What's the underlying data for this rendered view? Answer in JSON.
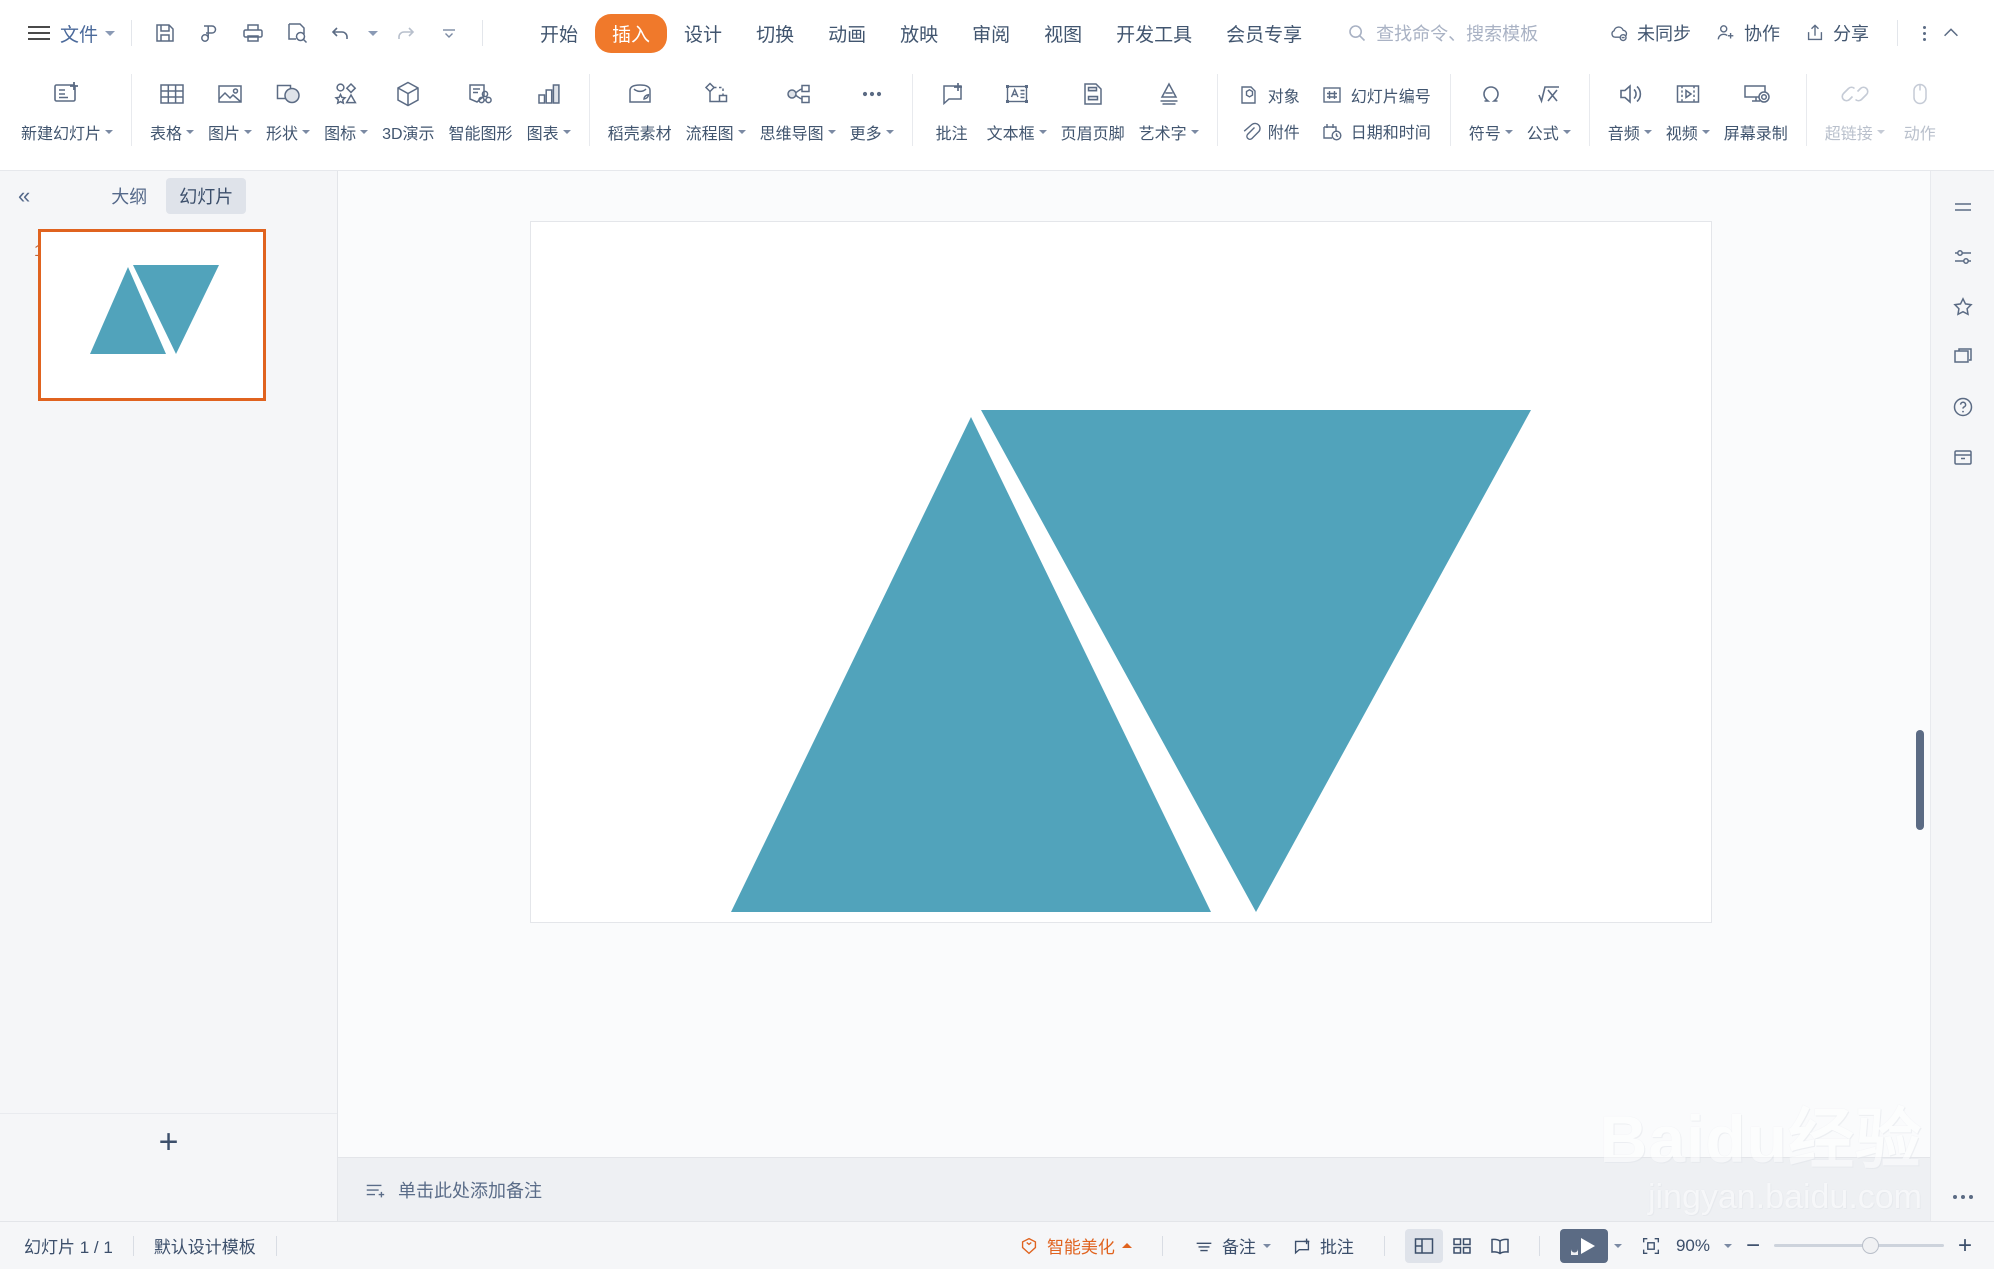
{
  "titlebar": {
    "menu_icon": "hamburger-icon",
    "file_label": "文件",
    "quick_access": [
      {
        "name": "save-icon",
        "label": "保存"
      },
      {
        "name": "cloud-save-icon",
        "label": "云同步"
      },
      {
        "name": "print-icon",
        "label": "打印"
      },
      {
        "name": "print-preview-icon",
        "label": "打印预览"
      },
      {
        "name": "undo-icon",
        "label": "撤销"
      },
      {
        "name": "redo-icon",
        "label": "恢复"
      },
      {
        "name": "customize-qat-icon",
        "label": "自定义快速访问工具栏"
      }
    ],
    "tabs": [
      {
        "label": "开始",
        "active": false
      },
      {
        "label": "插入",
        "active": true
      },
      {
        "label": "设计",
        "active": false
      },
      {
        "label": "切换",
        "active": false
      },
      {
        "label": "动画",
        "active": false
      },
      {
        "label": "放映",
        "active": false
      },
      {
        "label": "审阅",
        "active": false
      },
      {
        "label": "视图",
        "active": false
      },
      {
        "label": "开发工具",
        "active": false
      },
      {
        "label": "会员专享",
        "active": false
      }
    ],
    "search": {
      "icon": "search-icon",
      "placeholder": "查找命令、搜索模板"
    },
    "right_items": [
      {
        "icon": "cloud-sync-icon",
        "label": "未同步"
      },
      {
        "icon": "collaborate-icon",
        "label": "协作"
      },
      {
        "icon": "share-icon",
        "label": "分享"
      }
    ],
    "more_icon": "vertical-dots-icon",
    "collapse_ribbon_icon": "chevron-up-icon"
  },
  "ribbon": {
    "groups": [
      {
        "items": [
          {
            "icon": "new-slide-icon",
            "label": "新建幻灯片",
            "dropdown": true,
            "disabled": false
          }
        ]
      },
      {
        "items": [
          {
            "icon": "table-icon",
            "label": "表格",
            "dropdown": true,
            "disabled": false
          },
          {
            "icon": "picture-icon",
            "label": "图片",
            "dropdown": true,
            "disabled": false
          },
          {
            "icon": "shape-icon",
            "label": "形状",
            "dropdown": true,
            "disabled": false
          },
          {
            "icon": "iconlib-icon",
            "label": "图标",
            "dropdown": true,
            "disabled": false
          },
          {
            "icon": "cube-3d-icon",
            "label": "3D演示",
            "dropdown": false,
            "disabled": false
          },
          {
            "icon": "smartart-icon",
            "label": "智能图形",
            "dropdown": false,
            "disabled": false
          },
          {
            "icon": "chart-icon",
            "label": "图表",
            "dropdown": true,
            "disabled": false
          }
        ]
      },
      {
        "items": [
          {
            "icon": "docer-store-icon",
            "label": "稻壳素材",
            "dropdown": false,
            "disabled": false
          },
          {
            "icon": "flowchart-icon",
            "label": "流程图",
            "dropdown": true,
            "disabled": false
          },
          {
            "icon": "mindmap-icon",
            "label": "思维导图",
            "dropdown": true,
            "disabled": false
          },
          {
            "icon": "more-dots-icon",
            "label": "更多",
            "dropdown": true,
            "disabled": false
          }
        ]
      },
      {
        "items": [
          {
            "icon": "comment-add-icon",
            "label": "批注",
            "dropdown": false,
            "disabled": false
          },
          {
            "icon": "textbox-icon",
            "label": "文本框",
            "dropdown": true,
            "disabled": false
          },
          {
            "icon": "header-footer-icon",
            "label": "页眉页脚",
            "dropdown": false,
            "disabled": false
          },
          {
            "icon": "wordart-icon",
            "label": "艺术字",
            "dropdown": true,
            "disabled": false
          }
        ]
      },
      {
        "stacked": [
          [
            {
              "icon": "object-icon",
              "label": "对象"
            },
            {
              "icon": "slide-number-icon",
              "label": "幻灯片编号"
            }
          ],
          [
            {
              "icon": "attachment-icon",
              "label": "附件"
            },
            {
              "icon": "date-time-icon",
              "label": "日期和时间"
            }
          ]
        ]
      },
      {
        "items": [
          {
            "icon": "symbol-omega-icon",
            "label": "符号",
            "dropdown": true,
            "disabled": false
          },
          {
            "icon": "formula-icon",
            "label": "公式",
            "dropdown": true,
            "disabled": false
          }
        ]
      },
      {
        "items": [
          {
            "icon": "audio-icon",
            "label": "音频",
            "dropdown": true,
            "disabled": false
          },
          {
            "icon": "video-icon",
            "label": "视频",
            "dropdown": true,
            "disabled": false
          },
          {
            "icon": "screen-record-icon",
            "label": "屏幕录制",
            "dropdown": false,
            "disabled": false
          }
        ]
      },
      {
        "items": [
          {
            "icon": "hyperlink-icon",
            "label": "超链接",
            "dropdown": true,
            "disabled": true
          },
          {
            "icon": "action-mouse-icon",
            "label": "动作",
            "dropdown": false,
            "disabled": true
          }
        ]
      }
    ]
  },
  "left_panel": {
    "collapse_icon": "double-chevron-left-icon",
    "tabs": [
      {
        "label": "大纲",
        "active": false
      },
      {
        "label": "幻灯片",
        "active": true
      }
    ],
    "thumbnails": [
      {
        "number": "1",
        "selected": true
      }
    ],
    "add_slide_label": "+"
  },
  "slide": {
    "shape_color": "#51a3bb",
    "shapes": [
      {
        "name": "triangle-up",
        "color": "#51a3bb"
      },
      {
        "name": "triangle-down",
        "color": "#51a3bb"
      }
    ]
  },
  "notes": {
    "icon": "notes-icon",
    "placeholder": "单击此处添加备注"
  },
  "right_rail": [
    {
      "icon": "ruler-lines-icon",
      "label": "标尺"
    },
    {
      "icon": "format-panel-icon",
      "label": "属性"
    },
    {
      "icon": "design-idea-icon",
      "label": "设计灵感"
    },
    {
      "icon": "duplicate-icon",
      "label": "副本"
    },
    {
      "icon": "help-icon",
      "label": "帮助"
    },
    {
      "icon": "archive-icon",
      "label": "文档收纳"
    },
    {
      "icon": "more-horizontal-icon",
      "label": "更多"
    }
  ],
  "statusbar": {
    "slide_count": "幻灯片 1 / 1",
    "template": "默认设计模板",
    "beauty": {
      "icon": "beautify-icon",
      "label": "智能美化",
      "caret": "caret-up-icon"
    },
    "notes_btn": {
      "icon": "notes-lines-icon",
      "label": "备注",
      "dropdown": true
    },
    "comment_btn": {
      "icon": "comment-add-icon",
      "label": "批注"
    },
    "views": [
      {
        "icon": "normal-view-icon",
        "label": "普通视图",
        "active": true
      },
      {
        "icon": "slide-sorter-icon",
        "label": "幻灯片浏览",
        "active": false
      },
      {
        "icon": "reading-view-icon",
        "label": "阅读视图",
        "active": false
      }
    ],
    "play_button": {
      "icon": "play-slideshow-icon",
      "label": "从头开始",
      "dropdown": true
    },
    "fit_icon": "fit-to-window-icon",
    "zoom": {
      "value": "90%",
      "dropdown": true,
      "minus": "−",
      "plus": "+",
      "percent": 90
    }
  },
  "watermark": {
    "line1": "Baidu经验",
    "line2": "jingyan.baidu.com"
  }
}
